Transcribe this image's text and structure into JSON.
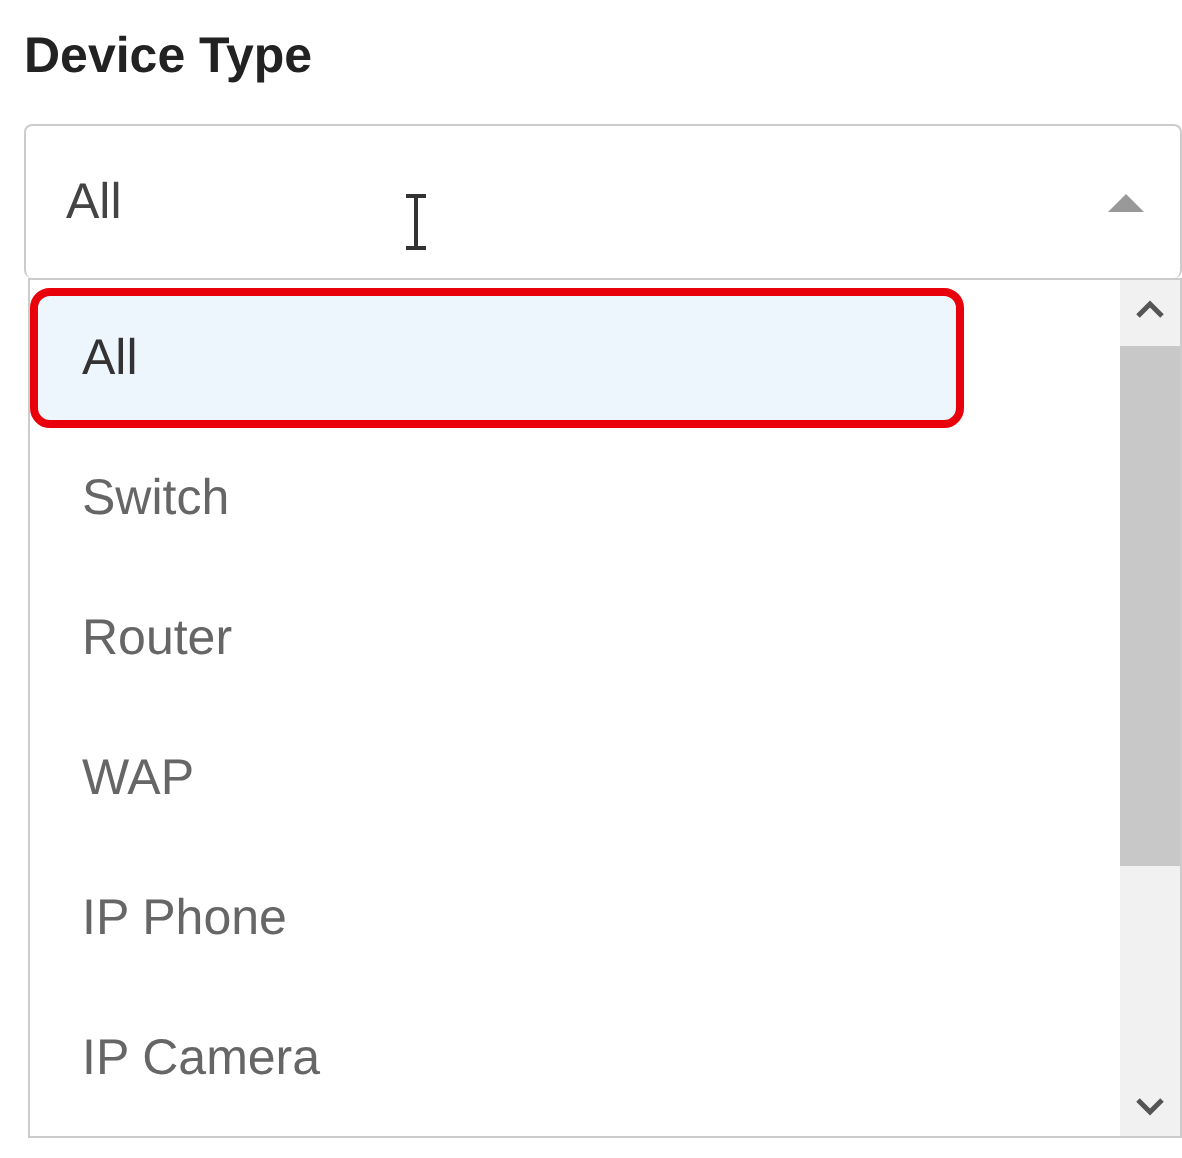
{
  "field": {
    "label": "Device Type",
    "value": "All",
    "expanded": true
  },
  "options": [
    {
      "label": "All",
      "selected": true
    },
    {
      "label": "Switch",
      "selected": false
    },
    {
      "label": "Router",
      "selected": false
    },
    {
      "label": "WAP",
      "selected": false
    },
    {
      "label": "IP Phone",
      "selected": false
    },
    {
      "label": "IP Camera",
      "selected": false
    }
  ]
}
